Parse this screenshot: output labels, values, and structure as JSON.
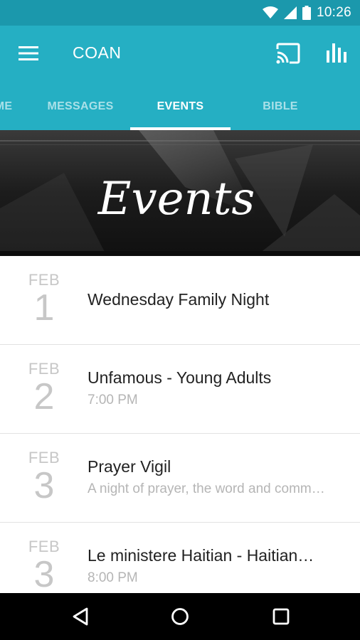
{
  "status_bar": {
    "time": "10:26",
    "icons": [
      "wifi-icon",
      "signal-icon",
      "battery-icon"
    ]
  },
  "app_bar": {
    "title": "COAN",
    "menu_icon": "hamburger-menu-icon",
    "actions": [
      "cast-icon",
      "stats-icon"
    ]
  },
  "tabs": [
    {
      "label": "ME",
      "active": false
    },
    {
      "label": "MESSAGES",
      "active": false
    },
    {
      "label": "EVENTS",
      "active": true
    },
    {
      "label": "BIBLE",
      "active": false
    }
  ],
  "banner": {
    "title": "Events"
  },
  "events": [
    {
      "month": "FEB",
      "day": "1",
      "title": "Wednesday Family Night",
      "subtitle": ""
    },
    {
      "month": "FEB",
      "day": "2",
      "title": "Unfamous - Young Adults",
      "subtitle": "7:00 PM"
    },
    {
      "month": "FEB",
      "day": "3",
      "title": "Prayer Vigil",
      "subtitle": "A night of prayer, the word and comm…"
    },
    {
      "month": "FEB",
      "day": "3",
      "title": "Le ministere Haitian - Haitian…",
      "subtitle": "8:00 PM"
    }
  ],
  "nav_bar": {
    "icons": [
      "back-icon",
      "home-icon",
      "recents-icon"
    ]
  },
  "colors": {
    "status_bar": "#1b98ac",
    "app_bar": "#25afc3",
    "tab_inactive": "#a9e0e8",
    "tab_active": "#ffffff",
    "date_gray": "#c7c7c7"
  }
}
